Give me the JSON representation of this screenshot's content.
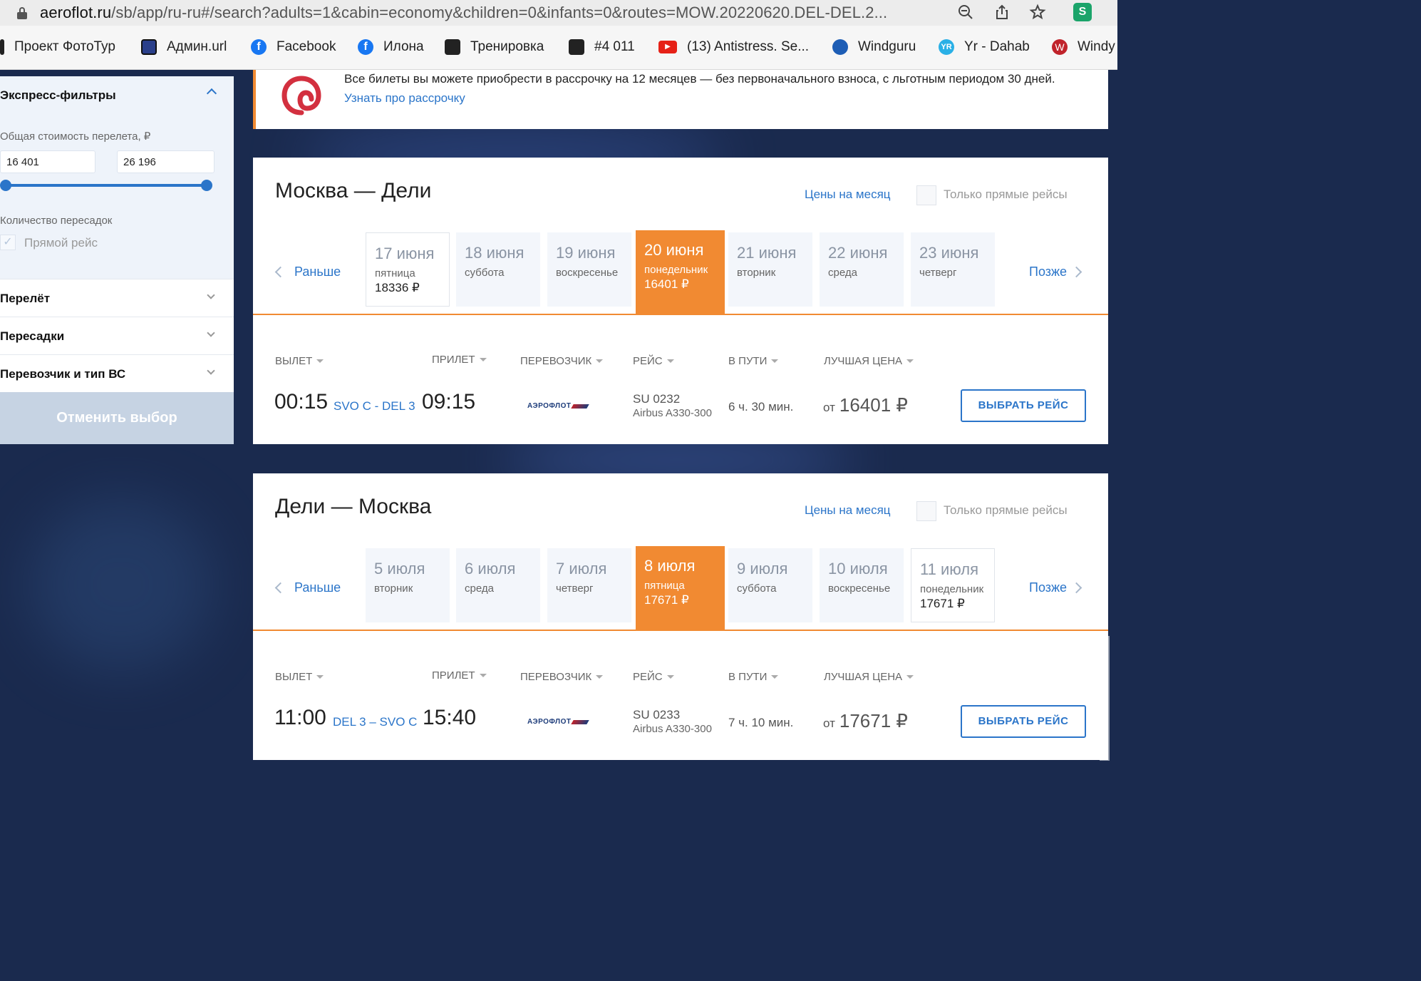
{
  "browser": {
    "url_host": "aeroflot.ru",
    "url_path": "/sb/app/ru-ru#/search?adults=1&cabin=economy&children=0&infants=0&routes=MOW.20220620.DEL-DEL.2...",
    "bookmarks": [
      {
        "label": "Проект ФотоТур",
        "icon": "bar-icon"
      },
      {
        "label": "Админ.url",
        "icon": "square-icon"
      },
      {
        "label": "Facebook",
        "icon": "facebook-icon"
      },
      {
        "label": "Илона",
        "icon": "facebook-icon"
      },
      {
        "label": "Тренировка",
        "icon": "grid-icon"
      },
      {
        "label": "#4 011",
        "icon": "grid-icon"
      },
      {
        "label": "(13) Antistress. Se...",
        "icon": "youtube-icon"
      },
      {
        "label": "Windguru",
        "icon": "windguru-icon"
      },
      {
        "label": "Yr - Dahab",
        "icon": "yr-icon"
      },
      {
        "label": "Windy",
        "icon": "windy-icon"
      }
    ]
  },
  "sidebar": {
    "title": "Экспресс-фильтры",
    "price_label": "Общая стоимость перелета, ₽",
    "price_min": "16 401",
    "price_max": "26 196",
    "stops_label": "Количество пересадок",
    "direct_label": "Прямой рейс",
    "sections": [
      "Перелёт",
      "Пересадки",
      "Перевозчик и тип ВС"
    ],
    "cancel_label": "Отменить выбор"
  },
  "banner": {
    "text": "Все билеты вы можете приобрести в рассрочку на 12 месяцев — без первоначального взноса, с льготным периодом 30 дней.",
    "link": "Узнать про рассрочку"
  },
  "common": {
    "month_link": "Цены на месяц",
    "direct_only": "Только прямые рейсы",
    "prev": "Раньше",
    "next": "Позже",
    "col_depart": "ВЫЛЕТ",
    "col_arrive": "ПРИЛЕТ",
    "col_carrier": "ПЕРЕВОЗЧИК",
    "col_flight": "РЕЙС",
    "col_duration": "В ПУТИ",
    "col_price": "ЛУЧШАЯ ЦЕНА",
    "carrier_name": "АЭРОФЛОТ",
    "price_from": "от",
    "select_label": "ВЫБРАТЬ РЕЙС"
  },
  "outbound": {
    "title": "Москва — Дели",
    "days": [
      {
        "date": "17 июня",
        "weekday": "пятница",
        "price": "18336 ₽",
        "state": "priced"
      },
      {
        "date": "18 июня",
        "weekday": "суббота",
        "price": "",
        "state": "plain"
      },
      {
        "date": "19 июня",
        "weekday": "воскресенье",
        "price": "",
        "state": "plain"
      },
      {
        "date": "20 июня",
        "weekday": "понедельник",
        "price": "16401 ₽",
        "state": "selected"
      },
      {
        "date": "21 июня",
        "weekday": "вторник",
        "price": "",
        "state": "plain"
      },
      {
        "date": "22 июня",
        "weekday": "среда",
        "price": "",
        "state": "plain"
      },
      {
        "date": "23 июня",
        "weekday": "четверг",
        "price": "",
        "state": "plain"
      }
    ],
    "flight": {
      "depart": "00:15",
      "route": "SVO C - DEL 3",
      "arrive": "09:15",
      "number": "SU 0232",
      "aircraft": "Airbus A330-300",
      "duration": "6 ч. 30 мин.",
      "price": "16401 ₽"
    }
  },
  "inbound": {
    "title": "Дели — Москва",
    "days": [
      {
        "date": "5 июля",
        "weekday": "вторник",
        "price": "",
        "state": "plain"
      },
      {
        "date": "6 июля",
        "weekday": "среда",
        "price": "",
        "state": "plain"
      },
      {
        "date": "7 июля",
        "weekday": "четверг",
        "price": "",
        "state": "plain"
      },
      {
        "date": "8 июля",
        "weekday": "пятница",
        "price": "17671 ₽",
        "state": "selected"
      },
      {
        "date": "9 июля",
        "weekday": "суббота",
        "price": "",
        "state": "plain"
      },
      {
        "date": "10 июля",
        "weekday": "воскресенье",
        "price": "",
        "state": "plain"
      },
      {
        "date": "11 июля",
        "weekday": "понедельник",
        "price": "17671 ₽",
        "state": "priced"
      }
    ],
    "flight": {
      "depart": "11:00",
      "route": "DEL 3 – SVO C",
      "arrive": "15:40",
      "number": "SU 0233",
      "aircraft": "Airbus A330-300",
      "duration": "7 ч. 10 мин.",
      "price": "17671 ₽"
    }
  }
}
